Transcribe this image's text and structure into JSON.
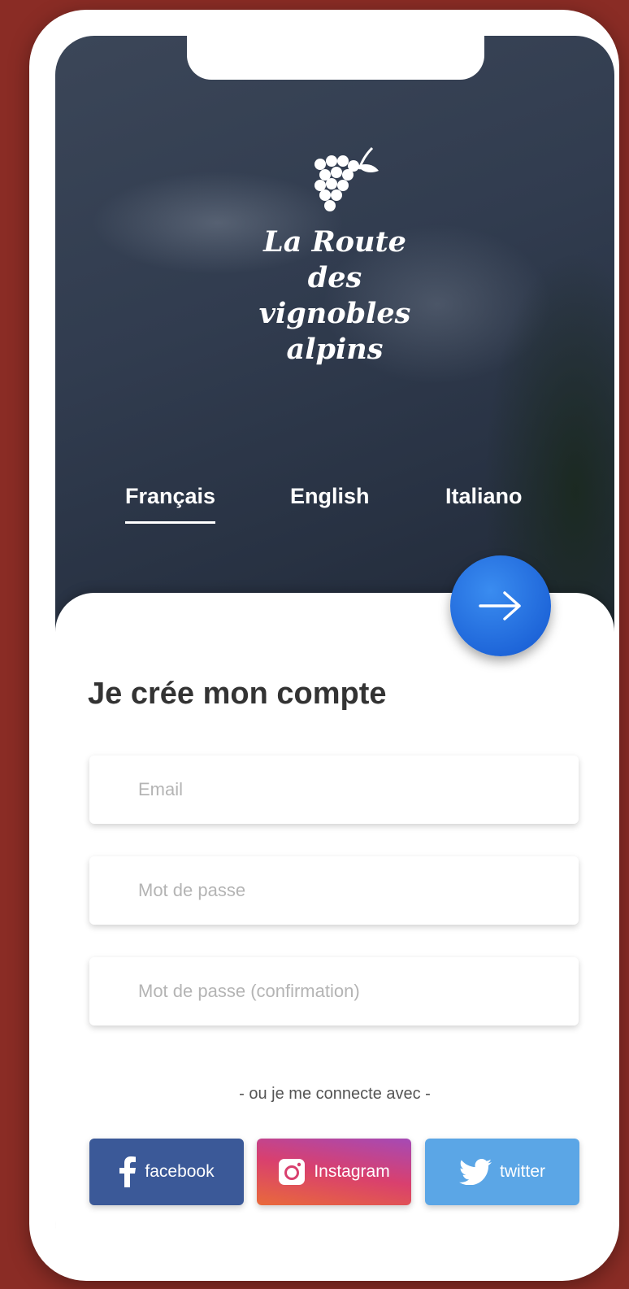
{
  "app": {
    "logo_text": "La Route\ndes\nvignobles\nalpins"
  },
  "languages": [
    {
      "label": "Français",
      "active": true
    },
    {
      "label": "English",
      "active": false
    },
    {
      "label": "Italiano",
      "active": false
    }
  ],
  "signup": {
    "title": "Je crée mon compte",
    "email_placeholder": "Email",
    "password_placeholder": "Mot de passe",
    "password_confirm_placeholder": "Mot de passe (confirmation)",
    "or_text": "- ou je me connecte avec -"
  },
  "social": {
    "facebook": "facebook",
    "instagram": "Instagram",
    "twitter": "twitter"
  },
  "icons": {
    "logo": "grapes-icon",
    "next": "arrow-right-icon",
    "facebook": "facebook-icon",
    "instagram": "instagram-icon",
    "twitter": "twitter-icon"
  },
  "colors": {
    "background": "#8a2c25",
    "accent": "#1d64d8",
    "facebook": "#3b5998",
    "twitter": "#5ba6e6"
  }
}
